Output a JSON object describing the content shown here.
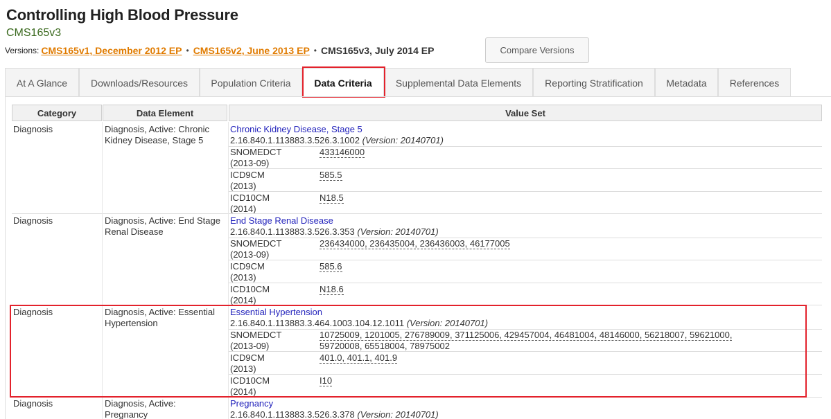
{
  "header": {
    "title": "Controlling High Blood Pressure",
    "subtitle": "CMS165v3",
    "versions_label": "Versions:",
    "versions": [
      {
        "label": "CMS165v1, December 2012 EP"
      },
      {
        "label": "CMS165v2, June 2013 EP"
      }
    ],
    "bullet": "•",
    "current_version": "CMS165v3, July 2014 EP",
    "compare_button": "Compare Versions"
  },
  "tabs": [
    {
      "label": "At A Glance"
    },
    {
      "label": "Downloads/Resources"
    },
    {
      "label": "Population Criteria"
    },
    {
      "label": "Data Criteria"
    },
    {
      "label": "Supplemental Data Elements"
    },
    {
      "label": "Reporting Stratification"
    },
    {
      "label": "Metadata"
    },
    {
      "label": "References"
    }
  ],
  "active_tab": "Data Criteria",
  "table": {
    "headers": [
      "Category",
      "Data Element",
      "Value Set"
    ],
    "rows": [
      {
        "category": "Diagnosis",
        "element": "Diagnosis, Active: Chronic Kidney Disease, Stage 5",
        "vs_name": "Chronic Kidney Disease, Stage 5",
        "oid": "2.16.840.1.113883.3.526.3.1002",
        "version": "(Version: 20140701)",
        "codes": [
          {
            "system": "SNOMEDCT",
            "year": "(2013-09)",
            "values": "433146000"
          },
          {
            "system": "ICD9CM",
            "year": "(2013)",
            "values": "585.5"
          },
          {
            "system": "ICD10CM",
            "year": "(2014)",
            "values": "N18.5"
          }
        ]
      },
      {
        "category": "Diagnosis",
        "element": "Diagnosis, Active: End Stage Renal Disease",
        "vs_name": "End Stage Renal Disease",
        "oid": "2.16.840.1.113883.3.526.3.353",
        "version": "(Version: 20140701)",
        "codes": [
          {
            "system": "SNOMEDCT",
            "year": "(2013-09)",
            "values": "236434000, 236435004, 236436003, 46177005"
          },
          {
            "system": "ICD9CM",
            "year": "(2013)",
            "values": "585.6"
          },
          {
            "system": "ICD10CM",
            "year": "(2014)",
            "values": "N18.6"
          }
        ]
      },
      {
        "category": "Diagnosis",
        "element": "Diagnosis, Active: Essential Hypertension",
        "vs_name": "Essential Hypertension",
        "oid": "2.16.840.1.113883.3.464.1003.104.12.1011",
        "version": "(Version: 20140701)",
        "codes": [
          {
            "system": "SNOMEDCT",
            "year": "(2013-09)",
            "values": "10725009, 1201005, 276789009, 371125006, 429457004, 46481004, 48146000, 56218007, 59621000,",
            "values2": "59720008, 65518004, 78975002"
          },
          {
            "system": "ICD9CM",
            "year": "(2013)",
            "values": "401.0, 401.1, 401.9"
          },
          {
            "system": "ICD10CM",
            "year": "(2014)",
            "values": "I10"
          }
        ]
      },
      {
        "category": "Diagnosis",
        "element": "Diagnosis, Active: Pregnancy",
        "vs_name": "Pregnancy",
        "oid": "2.16.840.1.113883.3.526.3.378",
        "version": "(Version: 20140701)"
      }
    ]
  },
  "colors": {
    "accent_orange": "#e07b00",
    "highlight_red": "#e3222c",
    "link_blue": "#2222bb"
  }
}
